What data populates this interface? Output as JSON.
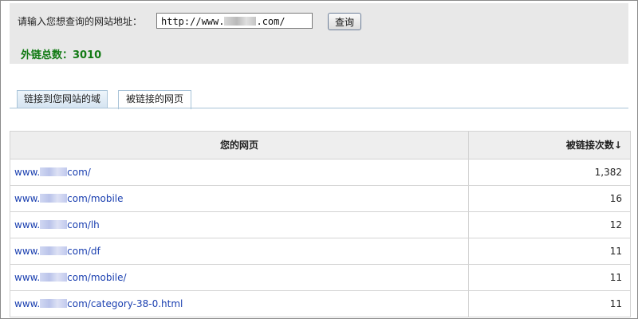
{
  "query": {
    "label": "请输入您想查询的网站地址：",
    "url_prefix": "http://www.",
    "url_suffix": ".com/",
    "button_label": "查询"
  },
  "summary": {
    "total_links_label": "外链总数：3010"
  },
  "tabs": [
    {
      "label": "链接到您网站的域",
      "active": false
    },
    {
      "label": "被链接的网页",
      "active": true
    }
  ],
  "table": {
    "headers": {
      "page": "您的网页",
      "count": "被链接次数",
      "sort_indicator": "↓"
    },
    "rows": [
      {
        "url_prefix": "www.",
        "url_suffix": "com/",
        "count": "1,382"
      },
      {
        "url_prefix": "www.",
        "url_suffix": "com/mobile",
        "count": "16"
      },
      {
        "url_prefix": "www.",
        "url_suffix": "com/lh",
        "count": "12"
      },
      {
        "url_prefix": "www.",
        "url_suffix": "com/df",
        "count": "11"
      },
      {
        "url_prefix": "www.",
        "url_suffix": "com/mobile/",
        "count": "11"
      },
      {
        "url_prefix": "www.",
        "url_suffix": "com/category-38-0.html",
        "count": "11"
      }
    ]
  },
  "colors": {
    "panel_bg": "#e8e8e8",
    "total_green": "#127a14",
    "link_blue": "#1a3fb0",
    "tab_border": "#a8c3d8"
  }
}
